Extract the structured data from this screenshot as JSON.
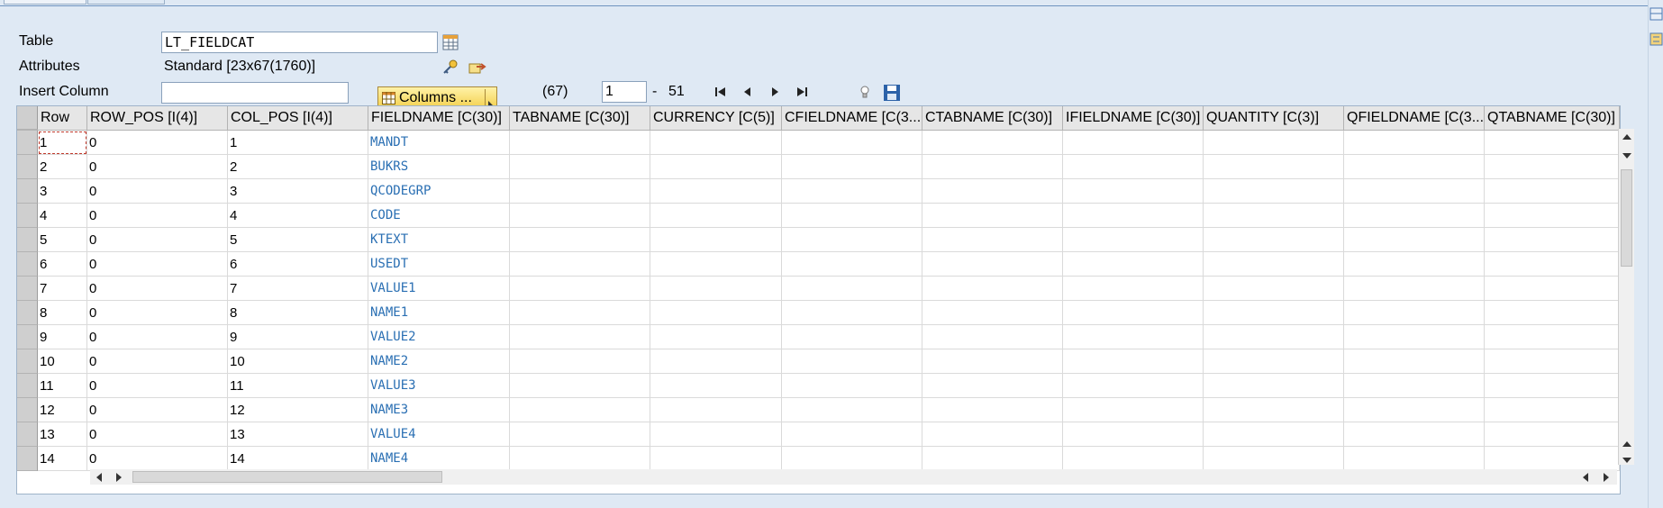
{
  "form": {
    "table_label": "Table",
    "table_value": "LT_FIELDCAT",
    "attributes_label": "Attributes",
    "attributes_value": "Standard [23x67(1760)]",
    "insert_column_label": "Insert Column",
    "insert_column_value": ""
  },
  "toolbar": {
    "columns_label": "Columns ...",
    "count": "(67)",
    "position_value": "1",
    "range_separator": "-",
    "range_end": "51"
  },
  "grid": {
    "headers": [
      "Row",
      "ROW_POS [I(4)]",
      "COL_POS [I(4)]",
      "FIELDNAME [C(30)]",
      "TABNAME [C(30)]",
      "CURRENCY [C(5)]",
      "CFIELDNAME [C(3...",
      "CTABNAME [C(30)]",
      "IFIELDNAME [C(30)]",
      "QUANTITY [C(3)]",
      "QFIELDNAME [C(3...",
      "QTABNAME [C(30)]"
    ],
    "rows": [
      [
        "1",
        "0",
        "1",
        "MANDT"
      ],
      [
        "2",
        "0",
        "2",
        "BUKRS"
      ],
      [
        "3",
        "0",
        "3",
        "QCODEGRP"
      ],
      [
        "4",
        "0",
        "4",
        "CODE"
      ],
      [
        "5",
        "0",
        "5",
        "KTEXT"
      ],
      [
        "6",
        "0",
        "6",
        "USEDT"
      ],
      [
        "7",
        "0",
        "7",
        "VALUE1"
      ],
      [
        "8",
        "0",
        "8",
        "NAME1"
      ],
      [
        "9",
        "0",
        "9",
        "VALUE2"
      ],
      [
        "10",
        "0",
        "10",
        "NAME2"
      ],
      [
        "11",
        "0",
        "11",
        "VALUE3"
      ],
      [
        "12",
        "0",
        "12",
        "NAME3"
      ],
      [
        "13",
        "0",
        "13",
        "VALUE4"
      ],
      [
        "14",
        "0",
        "14",
        "NAME4"
      ]
    ]
  },
  "icons": {
    "table_lookup": "table-lookup-icon",
    "key_edit": "key-edit-icon",
    "export": "export-icon",
    "columns_grid": "columns-grid-icon",
    "first": "first-page-icon",
    "prev": "previous-page-icon",
    "next": "next-page-icon",
    "last": "last-page-icon",
    "bulb": "lightbulb-icon",
    "save": "save-icon"
  },
  "colors": {
    "background": "#dfe9f4",
    "header_bg": "#e6e6e6",
    "fieldname_text": "#2a6fb3",
    "columns_button": "#f3cf4a"
  }
}
